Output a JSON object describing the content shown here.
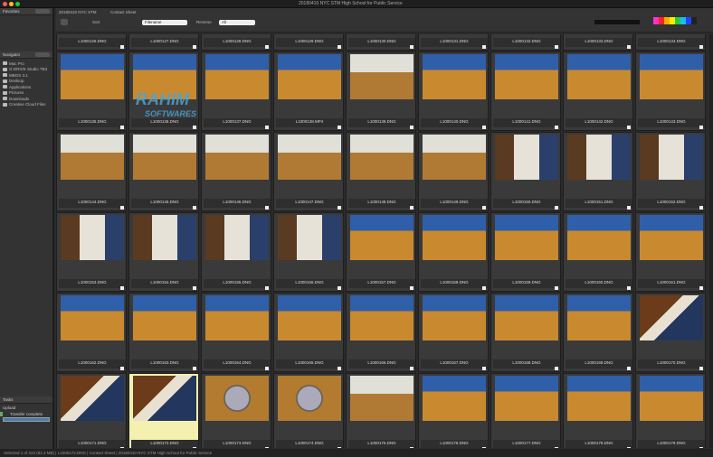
{
  "window": {
    "title": "20180410 NYC STM  High School for Public Service"
  },
  "sidebar": {
    "favorites_label": "Favorites",
    "navigator_label": "Navigator",
    "tasks_label": "Tasks",
    "tree": [
      "Mac Pro",
      "G-DRIVE Studio TB3",
      "MBOS 3.1",
      "Desktop",
      "Applications",
      "Pictures",
      "Downloads",
      "Creative Cloud Files"
    ],
    "task_name": "Upload",
    "task_status": "Transfer complete"
  },
  "toolbar": {
    "path": "20180410 NYC STM",
    "tab": "Contact Sheet",
    "sort_label": "Sort",
    "sort_value": "Filename",
    "filter_label": "Reverse",
    "filter_value": "All",
    "colors": [
      "#ff33cc",
      "#ff2222",
      "#ffaa00",
      "#ffee00",
      "#22cc44",
      "#22bbee",
      "#2244ff",
      "#222222"
    ]
  },
  "grid": {
    "top_labels": [
      "L1000126.DNG",
      "L1000127.DNG",
      "L1000128.DNG",
      "L1000129.DNG",
      "L1000130.DNG",
      "L1000131.DNG",
      "L1000132.DNG",
      "L1000133.DNG",
      "L1000134.DNG"
    ],
    "rows": [
      {
        "labels": [
          "L1000135.DNG",
          "L1000136.DNG",
          "L1000137.DNG",
          "L1000138.MP4",
          "L1000139.DNG",
          "L1000140.DNG",
          "L1000141.DNG",
          "L1000142.DNG",
          "L1000143.DNG"
        ],
        "scenes": [
          "gym",
          "gym",
          "gym",
          "gym",
          "gym2",
          "gym",
          "gym",
          "gym",
          "gym"
        ]
      },
      {
        "labels": [
          "L1000144.DNG",
          "L1000145.DNG",
          "L1000146.DNG",
          "L1000147.DNG",
          "L1000148.DNG",
          "L1000149.DNG",
          "L1000150.DNG",
          "L1000151.DNG",
          "L1000152.DNG"
        ],
        "scenes": [
          "gym2",
          "gym2",
          "gym2",
          "gym2",
          "gym2",
          "gym2",
          "hall",
          "hall",
          "hall"
        ]
      },
      {
        "labels": [
          "L1000153.DNG",
          "L1000154.DNG",
          "L1000155.DNG",
          "L1000156.DNG",
          "L1000157.DNG",
          "L1000158.DNG",
          "L1000159.DNG",
          "L1000160.DNG",
          "L1000161.DNG"
        ],
        "scenes": [
          "hall",
          "hall",
          "hall",
          "hall",
          "gym",
          "gym",
          "gym",
          "gym",
          "gym"
        ]
      },
      {
        "labels": [
          "L1000162.DNG",
          "L1000163.DNG",
          "L1000164.DNG",
          "L1000165.DNG",
          "L1000166.DNG",
          "L1000167.DNG",
          "L1000168.DNG",
          "L1000169.DNG",
          "L1000170.DNG"
        ],
        "scenes": [
          "gym",
          "gym",
          "gym",
          "gym",
          "gym",
          "gym",
          "gym",
          "gym",
          "piano"
        ]
      },
      {
        "labels": [
          "L1000171.DNG",
          "L1000172.DNG",
          "L1000173.DNG",
          "L1000174.DNG",
          "L1000175.DNG",
          "L1000176.DNG",
          "L1000177.DNG",
          "L1000178.DNG",
          "L1000179.DNG"
        ],
        "scenes": [
          "piano",
          "piano",
          "drum",
          "drum",
          "gym2",
          "gym",
          "gym",
          "gym",
          "gym"
        ],
        "highlight": 1
      }
    ]
  },
  "watermark": {
    "line1": "RAHIM",
    "line2": "SOFTWARES"
  },
  "status": "Selected 1 of 223 (62.3 MB) | L1000172.DNG | Contact Sheet | 20180410 NYC STM  High School for Public Service"
}
